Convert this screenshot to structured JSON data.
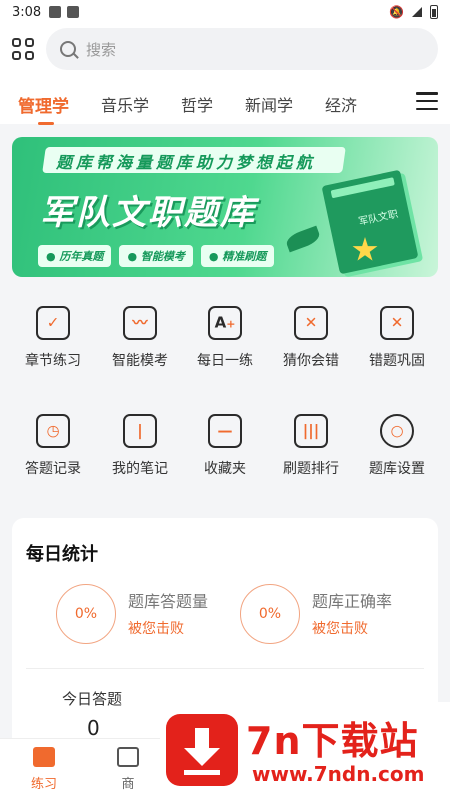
{
  "status_bar": {
    "time": "3:08"
  },
  "search": {
    "placeholder": "搜索"
  },
  "tabs": [
    {
      "label": "管理学",
      "active": true
    },
    {
      "label": "音乐学"
    },
    {
      "label": "哲学"
    },
    {
      "label": "新闻学"
    },
    {
      "label": "经济"
    }
  ],
  "banner": {
    "slogan": "题库帮海量题库助力梦想起航",
    "title": "军队文职题库",
    "pills": [
      "● 历年真题",
      "● 智能模考",
      "● 精准刷题"
    ],
    "book_label": "军队文职"
  },
  "grid": [
    {
      "label": "章节练习",
      "icon": "checkbox-icon"
    },
    {
      "label": "智能模考",
      "icon": "trend-chart-icon"
    },
    {
      "label": "每日一练",
      "icon": "daily-practice-icon"
    },
    {
      "label": "猜你会错",
      "icon": "guess-wrong-icon"
    },
    {
      "label": "错题巩固",
      "icon": "wrong-questions-icon"
    },
    {
      "label": "答题记录",
      "icon": "calendar-clock-icon"
    },
    {
      "label": "我的笔记",
      "icon": "notebook-icon"
    },
    {
      "label": "收藏夹",
      "icon": "folder-icon"
    },
    {
      "label": "刷题排行",
      "icon": "ranking-chart-icon"
    },
    {
      "label": "题库设置",
      "icon": "settings-icon"
    }
  ],
  "stats": {
    "title": "每日统计",
    "items": [
      {
        "value": "0%",
        "name": "题库答题量",
        "beat": "被您击败"
      },
      {
        "value": "0%",
        "name": "题库正确率",
        "beat": "被您击败"
      }
    ],
    "today_label": "今日答题",
    "today_value": "0"
  },
  "bottom_nav": [
    {
      "label": "练习",
      "active": true
    },
    {
      "label": "商"
    }
  ],
  "watermark": {
    "title": "7n下载站",
    "url": "www.7ndn.com"
  },
  "colors": {
    "accent": "#f06a2e",
    "banner_green": "#2fc07a",
    "watermark_red": "#e3221b"
  }
}
